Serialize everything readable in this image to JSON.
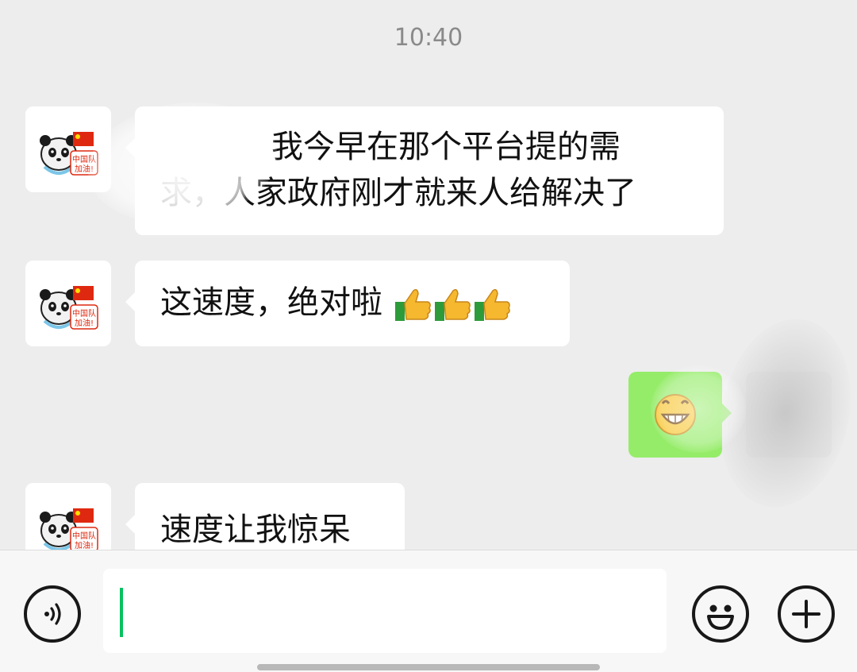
{
  "chat": {
    "timestamp": "10:40",
    "messages": [
      {
        "side": "left",
        "lines": [
          "我今早在那个平台提的需",
          "求，人家政府刚才就来人给解决了"
        ]
      },
      {
        "side": "left",
        "text": "这速度，绝对啦",
        "emoji": [
          "thumbs-up",
          "thumbs-up",
          "thumbs-up"
        ]
      },
      {
        "side": "right",
        "emoji": [
          "grinning-face"
        ]
      },
      {
        "side": "left",
        "text": "速度让我惊呆"
      }
    ]
  },
  "avatar": {
    "badge_line1": "中国队",
    "badge_line2": "加油!",
    "flag_color": "#de2910"
  },
  "input_bar": {
    "voice_icon": "voice-icon",
    "emoji_icon": "emoji-icon",
    "more_icon": "plus-icon",
    "value": ""
  },
  "colors": {
    "accent": "#07c160",
    "self_bubble": "#95ec69",
    "background": "#ededed"
  }
}
